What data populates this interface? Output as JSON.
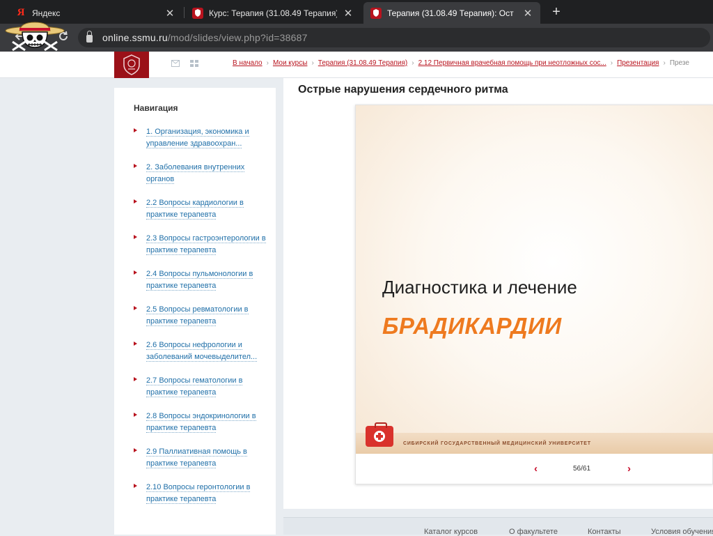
{
  "browser": {
    "tabs": [
      {
        "title": "Яндекс",
        "favicon": "yandex-icon",
        "active": false
      },
      {
        "title": "Курс: Терапия (31.08.49 Терапия)",
        "favicon": "university-crest-icon",
        "active": false
      },
      {
        "title": "Терапия (31.08.49 Терапия): Ост",
        "favicon": "university-crest-icon",
        "active": true
      }
    ],
    "favicon_letter": "Я",
    "close_glyph": "✕",
    "newtab_glyph": "+",
    "url_host": "online.ssmu.ru",
    "url_path": "/mod/slides/view.php?id=38687"
  },
  "site": {
    "brand_color": "#9b1118",
    "breadcrumb": [
      "В начало",
      "Мои курсы",
      "Терапия (31.08.49 Терапия)",
      "2.12 Первичная врачебная помощь при неотложных сос...",
      "Презентация"
    ],
    "breadcrumb_tail": "Презе",
    "breadcrumb_sep": "›"
  },
  "sidebar": {
    "title": "Навигация",
    "items": [
      {
        "label": "1. Организация, экономика и управление здравоохран..."
      },
      {
        "label": "2. Заболевания внутренних органов"
      },
      {
        "label": "2.2 Вопросы кардиологии в практике терапевта"
      },
      {
        "label": "2.3 Вопросы гастроэнтерологии в практике терапевта"
      },
      {
        "label": "2.4 Вопросы пульмонологии в практике терапевта"
      },
      {
        "label": "2.5 Вопросы ревматологии в практике терапевта"
      },
      {
        "label": "2.6 Вопросы нефрологии и заболеваний мочевыделител..."
      },
      {
        "label": "2.7 Вопросы гематологии в практике терапевта"
      },
      {
        "label": "2.8 Вопросы эндокринологии в практике терапевта"
      },
      {
        "label": "2.9 Паллиативная помощь в практике терапевта"
      },
      {
        "label": "2.10 Вопросы геронтологии в практике терапевта"
      }
    ]
  },
  "main": {
    "title": "Острые нарушения сердечного ритма",
    "slide": {
      "title": "Диагностика и лечение",
      "accent": "БРАДИКАРДИИ",
      "accent_color": "#ee7a1f",
      "university": "СИБИРСКИЙ ГОСУДАРСТВЕННЫЙ МЕДИЦИНСКИЙ УНИВЕРСИТЕТ"
    },
    "pager": {
      "prev": "‹",
      "next": "›",
      "count": "56/61"
    }
  },
  "footer": {
    "links": [
      "Каталог курсов",
      "О факультете",
      "Контакты",
      "Условия обучения"
    ]
  }
}
